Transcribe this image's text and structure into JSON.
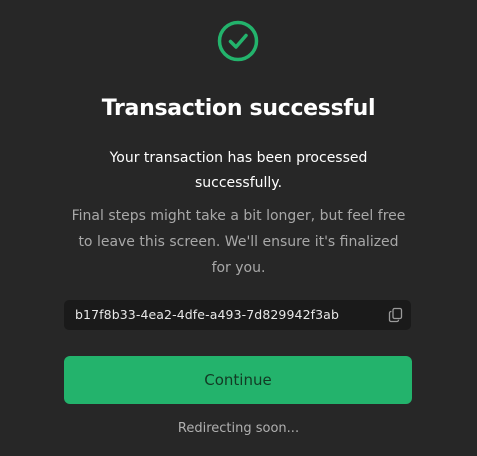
{
  "colors": {
    "accent": "#23b36c",
    "background": "#272727",
    "field_background": "#1a1a1a"
  },
  "icons": {
    "status": "check-circle-icon",
    "copy": "copy-icon"
  },
  "title": "Transaction successful",
  "subtitle": "Your transaction has been processed successfully.",
  "note": "Final steps might take a bit longer, but feel free to leave this screen. We'll ensure it's finalized for you.",
  "transaction_id": "b17f8b33-4ea2-4dfe-a493-7d829942f3ab",
  "continue_label": "Continue",
  "status_text": "Redirecting soon..."
}
